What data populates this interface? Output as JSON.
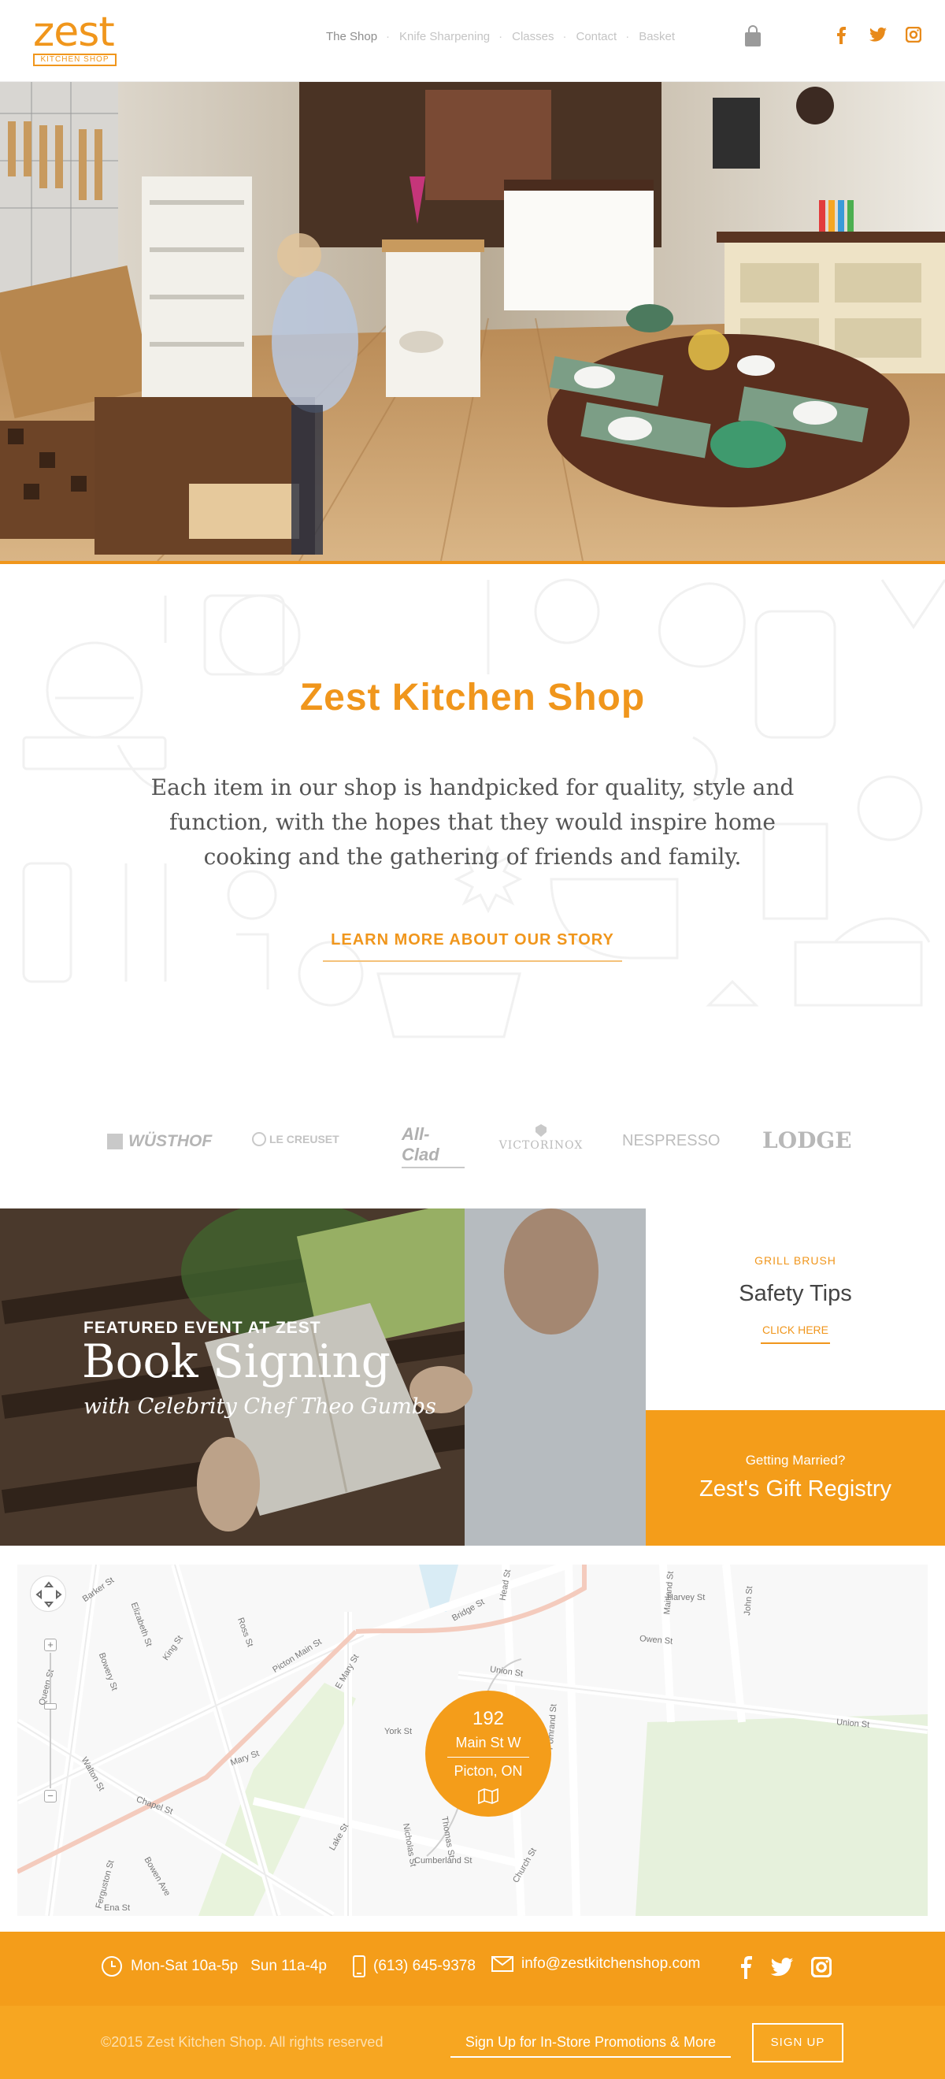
{
  "header": {
    "logo_word": "zest",
    "logo_sub": "KITCHEN SHOP",
    "nav": [
      "The Shop",
      "Knife Sharpening",
      "Classes",
      "Contact",
      "Basket"
    ]
  },
  "intro": {
    "title": "Zest Kitchen Shop",
    "text": "Each item in our shop is handpicked for quality, style and function, with the hopes that they would inspire home cooking and the gathering of friends and family.",
    "link": "LEARN MORE ABOUT OUR STORY"
  },
  "brands": [
    "WÜSTHOF",
    "LE CREUSET",
    "All-Clad",
    "VICTORINOX",
    "NESPRESSO",
    "LODGE"
  ],
  "event": {
    "kicker": "FEATURED EVENT AT ZEST",
    "title": "Book Signing",
    "subtitle": "with Celebrity Chef Theo Gumbs"
  },
  "tips": {
    "kicker": "GRILL BRUSH",
    "title": "Safety Tips",
    "link": "CLICK HERE"
  },
  "registry": {
    "kicker": "Getting Married?",
    "title": "Zest's Gift Registry"
  },
  "map": {
    "pin_number": "192",
    "pin_street": "Main St W",
    "pin_city": "Picton, ON",
    "streets": [
      "Barker St",
      "Queen St",
      "Elizabeth St",
      "Bowery St",
      "King St",
      "Ross St",
      "Picton Main St",
      "E Mary St",
      "Bridge St",
      "Head St",
      "Union St",
      "Owen St",
      "Harvey St",
      "Maitland St",
      "John St",
      "York St",
      "Mary St",
      "Chapel St",
      "Walton St",
      "Lake St",
      "Nicholas St",
      "Thomas St",
      "Cumberland St",
      "Church St",
      "Pomrand St",
      "Ferguston St",
      "Bowen Ave",
      "Ena St",
      "Queen St"
    ]
  },
  "footer": {
    "hours": "Mon-Sat 10a-5p   Sun 11a-4p",
    "phone": "(613) 645-9378",
    "email": "info@zestkitchenshop.com",
    "copyright": "©2015 Zest Kitchen Shop. All rights reserved",
    "signup_placeholder": "Sign Up for In-Store Promotions & More",
    "signup_button": "SIGN UP"
  },
  "colors": {
    "accent": "#f0961c",
    "footer_top": "#f49d1a",
    "footer_bottom": "#f7a621"
  }
}
